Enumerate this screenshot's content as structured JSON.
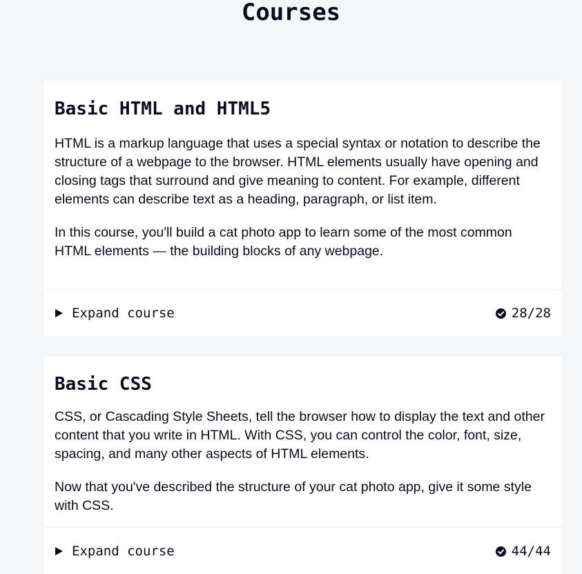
{
  "page": {
    "title": "Courses"
  },
  "courses": [
    {
      "title": "Basic HTML and HTML5",
      "description": [
        "HTML is a markup language that uses a special syntax or notation to describe the structure of a webpage to the browser. HTML elements usually have opening and closing tags that surround and give meaning to content. For example, different elements can describe text as a heading, paragraph, or list item.",
        "In this course, you'll build a cat photo app to learn some of the most common HTML elements — the building blocks of any webpage."
      ],
      "expand_label": "Expand course",
      "progress": "28/28",
      "progress_icon": "check-circle-icon"
    },
    {
      "title": "Basic CSS",
      "description": [
        "CSS, or Cascading Style Sheets, tell the browser how to display the text and other content that you write in HTML. With CSS, you can control the color, font, size, spacing, and many other aspects of HTML elements.",
        "Now that you've described the structure of your cat photo app, give it some style with CSS."
      ],
      "expand_label": "Expand course",
      "progress": "44/44",
      "progress_icon": "check-circle-icon"
    }
  ],
  "colors": {
    "background": "#f5f6f7",
    "card": "#ffffff",
    "text": "#0a0a23"
  }
}
